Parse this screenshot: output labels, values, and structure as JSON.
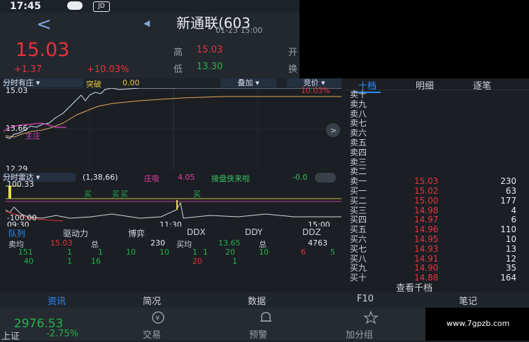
{
  "status": {
    "time": "17:45",
    "badge": "JD"
  },
  "header": {
    "title": "新通联(603",
    "datetime": "01-23 15:00",
    "price": "15.03",
    "change": "+1.37",
    "change_pct": "+10.03%",
    "high_label": "高",
    "high_value": "15.03",
    "low_label": "低",
    "low_value": "13.30",
    "open_label_partial": "开",
    "turn_label_partial": "换"
  },
  "chart_tabs": {
    "mode": "分时有庄",
    "breakout_label": "突破",
    "breakout_value": "0.00",
    "overlay": "叠加",
    "auction": "竞价"
  },
  "chart": {
    "price_top": "15.03",
    "pct_top": "10.03%",
    "price_mid": "13.66",
    "price_bottom": "12.29",
    "marker_label": "主庄"
  },
  "indicator": {
    "name": "分时雷达",
    "params": "(1,38,66)",
    "absorb_label": "庄吸",
    "absorb_value": "4.05",
    "relay_label": "接盘侠来啦",
    "relay_value": "-0.0",
    "top_value": "100.33",
    "bottom_value": "-100.00",
    "buy_marks": [
      "买",
      "买",
      "买",
      "买"
    ],
    "time_start": "09:30",
    "time_mid": "11:30",
    "time_end": "15:00"
  },
  "sub_tabs": [
    "队列",
    "驱动力",
    "博弈",
    "DDX",
    "DDY",
    "DDZ"
  ],
  "queue": {
    "sell_avg_label": "卖均",
    "sell_avg": "15.03",
    "total_label1": "总",
    "total_value1": "230",
    "buy_avg_label": "买均",
    "buy_avg": "13.65",
    "total_label2": "总",
    "total_value2": "4763",
    "row1": [
      "151",
      "1",
      "1",
      "10",
      "10",
      "1",
      "1",
      "20",
      "10",
      "6",
      "5"
    ],
    "row2": [
      "40",
      "1",
      "16",
      "20",
      "1"
    ]
  },
  "right_tabs": [
    "十档",
    "明细",
    "逐笔"
  ],
  "order_book": {
    "asks": [
      {
        "label": "卖十"
      },
      {
        "label": "卖九"
      },
      {
        "label": "卖八"
      },
      {
        "label": "卖七"
      },
      {
        "label": "卖六"
      },
      {
        "label": "卖五"
      },
      {
        "label": "卖四"
      },
      {
        "label": "卖三"
      },
      {
        "label": "卖二"
      },
      {
        "label": "卖一",
        "price": "15.03",
        "vol": "230"
      }
    ],
    "bids": [
      {
        "label": "买一",
        "price": "15.02",
        "vol": "63"
      },
      {
        "label": "买二",
        "price": "15.00",
        "vol": "177"
      },
      {
        "label": "买三",
        "price": "14.98",
        "vol": "4"
      },
      {
        "label": "买四",
        "price": "14.97",
        "vol": "6"
      },
      {
        "label": "买五",
        "price": "14.96",
        "vol": "110"
      },
      {
        "label": "买六",
        "price": "14.95",
        "vol": "10"
      },
      {
        "label": "买七",
        "price": "14.93",
        "vol": "13"
      },
      {
        "label": "买八",
        "price": "14.91",
        "vol": "12"
      },
      {
        "label": "买九",
        "price": "14.90",
        "vol": "35"
      },
      {
        "label": "买十",
        "price": "14.88",
        "vol": "164"
      }
    ],
    "view_all": "查看千档"
  },
  "bottom_tabs": [
    "资讯",
    "简况",
    "数据",
    "F10",
    "笔记"
  ],
  "index": {
    "value": "2976.53",
    "name": "上证",
    "pct": "-2.75%"
  },
  "nav": {
    "trade": "交易",
    "alert": "预警",
    "add_group": "加分组"
  },
  "watermark": "www.7gpzb.com",
  "colors": {
    "up": "#e8333b",
    "down": "#23b14d",
    "accent": "#2e8bff",
    "bg": "#1d2228"
  }
}
